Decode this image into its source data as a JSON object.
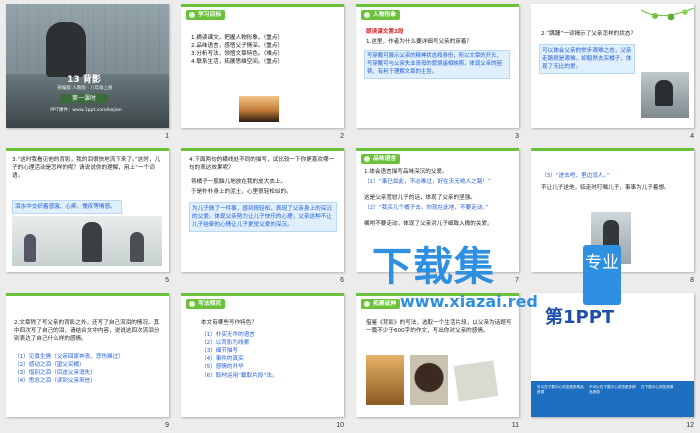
{
  "slides": [
    {
      "num": "1",
      "title": "13 背影",
      "subtitle": "部编版 人教版 · 八年级上册",
      "pill": "第一课时",
      "url": "PPT课件：www.1ppt.com/kejian"
    },
    {
      "num": "2",
      "tag": "学习目标",
      "items": [
        "1.摘读课文，把握人物形象。（重点）",
        "2.品味语言，感悟父子情深。（重点）",
        "3.分析写法，领悟文章特色。（难点）",
        "4.联系生活，拓展思维空间。（重点）"
      ]
    },
    {
      "num": "3",
      "tag": "人物形象",
      "head": "朗读课文第2段",
      "q": "1.这里，作者为什么要详细写父亲的穿着？",
      "a": "写穿戴可展示父亲的精神状态和身份，所以文章的开头，写穿戴可与父亲失业丧母的窘境遥相映照，体现父亲的困顿，有利于理解文章的主旨。"
    },
    {
      "num": "4",
      "q": "2.“蹒跚”一词揭示了父亲怎样的状态？",
      "a": "可以体会父亲的举步艰难之态，父亲走路很是艰难，却毅然去买橘子，体现了无比的爱。"
    },
    {
      "num": "5",
      "q": "3.“这时我看见他的背影，我的泪很快地流下来了。”这时，儿子的心理活动是怎样的呢？请说说你的理解，用上“一个词语。",
      "a": "泪水中交织着感激、心疼、愧疚等情感。"
    },
    {
      "num": "6",
      "q": "4.下面两句的横线处不同的描写，试比较一下你更喜欢哪一句的表达效果呢？",
      "l1": "将橘子一股脑儿地放在我的皮大衣上。",
      "l2": "于是朴朴身上的泥土，心里很轻松似的。",
      "a": "为儿子做了一件事，感到很轻松，表现了父亲身上的深沉的父爱。体现父亲努力让儿子快乐的心理，父亲这种不让儿子挂牵的心情让儿子更觉父爱的深沉。"
    },
    {
      "num": "7",
      "tag": "品味语言",
      "q": "1.体会语言描写品味深沉的父爱。",
      "i1": "（1）“事已如此，不必难过，好在天无绝人之路！”",
      "a1": "这是父亲宽慰儿子的话，体现了父亲的坚强。",
      "i2": "（2）“我买几个橘子去。你就在此地，不要走动。”",
      "a2": "嘱咐不要走动，体现了父亲对儿子细致入微的关爱。"
    },
    {
      "num": "8",
      "q": "（3）“进去吧，里边没人。”",
      "a": "不让儿子送他，临走时叮嘱儿子，事事为儿子着想。"
    },
    {
      "num": "9",
      "q": "2.文章除了写父亲的背影之外，还写了自己流泪的情况。其中四次写了自己的泪，请结合文中内容，说说这四次流泪分别表达了自己什么样的感情。",
      "items": [
        "（1）见景生情（父亲回家奔丧，悲伤难过）",
        "（2）感动之泪（望父买橘）",
        "（3）惜别之泪（目送父亲消失）",
        "（4）思念之泪（读到父亲来信）"
      ]
    },
    {
      "num": "10",
      "tag": "写法探究",
      "q": "本文有哪些写作特色？",
      "items": [
        "（1）朴实无华的语言",
        "（2）以背影为线索",
        "（3）细节描写",
        "（4）事件的真实",
        "（5）感情的升华",
        "（6）取材运用“截取片段”法。"
      ]
    },
    {
      "num": "11",
      "tag": "拓展延伸",
      "q": "借鉴《背影》的写法，选取一个生活片段，以父亲为话题写一篇不少于600字的作文，写出你对父亲的感情。"
    },
    {
      "num": "12",
      "logo": "第1PPT",
      "c1": "可以在下载中心浏览更多精品资源",
      "c2": "不可以在下载中心浏览更多精品资源",
      "c3": "在下载中心浏览资源"
    }
  ],
  "watermark": {
    "big": "下载集",
    "pro": "专业",
    "url": "www.xiazai.red"
  }
}
